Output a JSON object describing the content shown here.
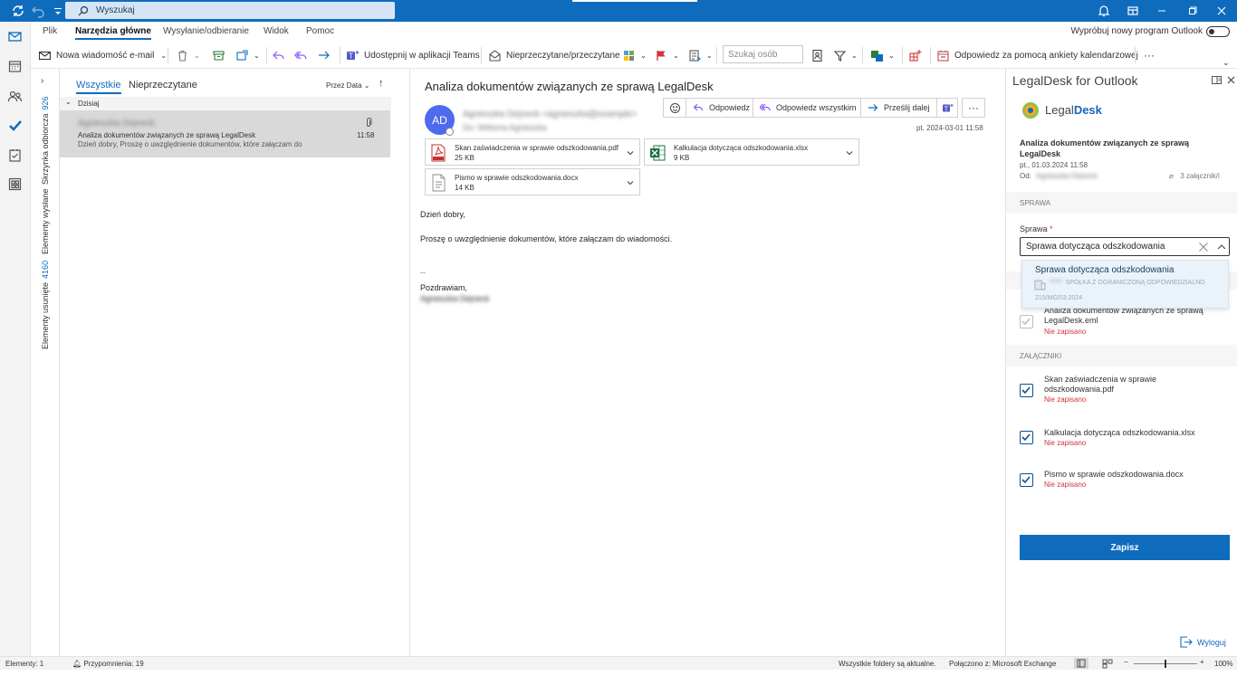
{
  "titlebar": {
    "search_placeholder": "Wyszukaj"
  },
  "menu": {
    "tabs": [
      "Plik",
      "Narzędzia główne",
      "Wysyłanie/odbieranie",
      "Widok",
      "Pomoc"
    ],
    "active_tab": "Narzędzia główne",
    "try_new_label": "Wypróbuj nowy program Outlook"
  },
  "ribbon": {
    "new_email": "Nowa wiadomość e-mail",
    "share_teams": "Udostępnij w aplikacji Teams",
    "unread_read": "Nieprzeczytane/przeczytane",
    "search_people_placeholder": "Szukaj osób",
    "reply_poll": "Odpowiedz za pomocą ankiety kalendarzowej",
    "more": "···"
  },
  "folders": {
    "inbox": {
      "label": "Skrzynka odbiorcza",
      "count": "926"
    },
    "sent": {
      "label": "Elementy wysłane"
    },
    "deleted": {
      "label": "Elementy usunięte",
      "count": "4160"
    }
  },
  "message_list": {
    "tab_all": "Wszystkie",
    "tab_unread": "Nieprzeczytane",
    "sort_label": "Przez Data",
    "group_today": "Dzisiaj",
    "item": {
      "sender": "Agnieszka Dejneck",
      "subject": "Analiza dokumentów związanych ze sprawą LegalDesk",
      "preview": "Dzień dobry,  Proszę o uwzględnienie dokumentów, które załączam do",
      "time": "11:58"
    }
  },
  "reading": {
    "subject": "Analiza dokumentów związanych ze sprawą LegalDesk",
    "avatar_initials": "AD",
    "from_blurred": "Agnieszka Dejneck <agnieszka@example>",
    "to_blurred": "Do: Wiktoria Agnieszka",
    "date": "pt. 2024-03-01 11:58",
    "actions": {
      "reply": "Odpowiedz",
      "reply_all": "Odpowiedz wszystkim",
      "forward": "Prześlij dalej"
    },
    "attachments": [
      {
        "name": "Skan zaświadczenia w sprawie odszkodowania.pdf",
        "size": "25 KB",
        "icon": "pdf-icon"
      },
      {
        "name": "Kalkulacja dotycząca odszkodowania.xlsx",
        "size": "9 KB",
        "icon": "excel-icon"
      },
      {
        "name": "Pismo w sprawie odszkodowania.docx",
        "size": "14 KB",
        "icon": "doc-icon"
      }
    ],
    "body": {
      "greeting": "Dzień dobry,",
      "paragraph": "Proszę o uwzględnienie dokumentów, które załączam do wiadomości.",
      "separator": "--",
      "closing": "Pozdrawiam,",
      "signature_blurred": "Agnieszka Dejneck"
    }
  },
  "addin": {
    "title": "LegalDesk for Outlook",
    "logo_text_a": "Legal",
    "logo_text_b": "Desk",
    "mail_subject": "Analiza dokumentów związanych ze sprawą LegalDesk",
    "mail_date": "pt., 01.03.2024 11:58",
    "from_label": "Od:",
    "from_blurred": "Agnieszka Dejneck",
    "attachment_count": "3 załącznik/i",
    "section_case": "SPRAWA",
    "case_label": "Sprawa",
    "required_mark": "*",
    "case_value": "Sprawa dotycząca odszkodowania",
    "dropdown": {
      "option_title": "Sprawa dotycząca odszkodowania",
      "company_blurred": "*****",
      "company": "SPÓŁKA Z OGRANICZONĄ ODPOWIEDZIALNO",
      "code": "215/MG/03.2024"
    },
    "eml_name": "Analiza dokumentów związanych ze sprawą LegalDesk.eml",
    "eml_status": "Nie zapisano",
    "section_attachments": "ZAŁĄCZNIKI",
    "attachment_items": [
      {
        "name": "Skan zaświadczenia w sprawie odszkodowania.pdf",
        "status": "Nie zapisano"
      },
      {
        "name": "Kalkulacja dotycząca odszkodowania.xlsx",
        "status": "Nie zapisano"
      },
      {
        "name": "Pismo w sprawie odszkodowania.docx",
        "status": "Nie zapisano"
      }
    ],
    "save_button": "Zapisz",
    "logout": "Wyloguj"
  },
  "statusbar": {
    "elements": "Elementy: 1",
    "reminders": "Przypomnienia: 19",
    "folders_status": "Wszystkie foldery są aktualne.",
    "connection": "Połączono z: Microsoft Exchange",
    "zoom": "100%"
  },
  "colors": {
    "accent": "#0f6cbd",
    "error": "#d13438",
    "avatar": "#4f6bed"
  }
}
